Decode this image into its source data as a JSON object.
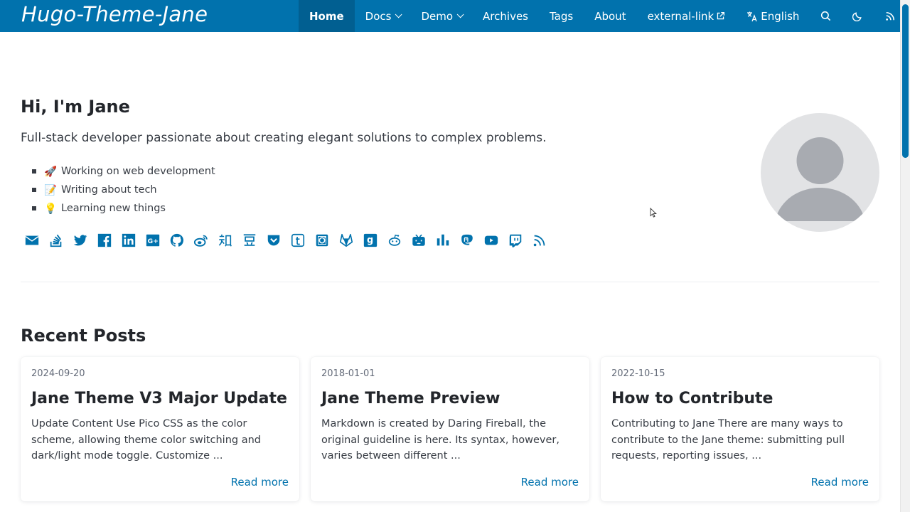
{
  "header": {
    "logo": "Hugo-Theme-Jane",
    "nav": [
      {
        "label": "Home",
        "active": true
      },
      {
        "label": "Docs",
        "dropdown": true
      },
      {
        "label": "Demo",
        "dropdown": true
      },
      {
        "label": "Archives"
      },
      {
        "label": "Tags"
      },
      {
        "label": "About"
      },
      {
        "label": "external-link",
        "icon": "external-link-icon"
      },
      {
        "label": "English",
        "icon": "translate-icon"
      }
    ],
    "icons": [
      "search-icon",
      "moon-icon",
      "rss-icon"
    ],
    "color": "#0172ad"
  },
  "hero": {
    "title": "Hi, I'm Jane",
    "subtitle": "Full-stack developer passionate about creating elegant solutions to complex problems.",
    "items": [
      {
        "emoji": "🚀",
        "text": "Working on web development"
      },
      {
        "emoji": "📝",
        "text": "Writing about tech"
      },
      {
        "emoji": "💡",
        "text": "Learning new things"
      }
    ],
    "socials": [
      "email-icon",
      "stackoverflow-icon",
      "twitter-icon",
      "facebook-icon",
      "linkedin-icon",
      "google-plus-icon",
      "github-icon",
      "weibo-icon",
      "zhihu-icon",
      "douban-icon",
      "pocket-icon",
      "tumblr-icon",
      "instagram-icon",
      "gitlab-icon",
      "goodreads-icon",
      "reddit-icon",
      "bilibili-icon",
      "stats-icon",
      "mastodon-icon",
      "youtube-icon",
      "twitch-icon",
      "rss-icon"
    ]
  },
  "recent": {
    "title": "Recent Posts",
    "posts": [
      {
        "date": "2024-09-20",
        "title": "Jane Theme V3 Major Update",
        "excerpt": "Update Content Use Pico CSS as the color scheme, allowing theme color switching and dark/light mode toggle. Customize ...",
        "more": "Read more"
      },
      {
        "date": "2018-01-01",
        "title": "Jane Theme Preview",
        "excerpt": "Markdown is created by Daring Fireball, the original guideline is here. Its syntax, however, varies between different ...",
        "more": "Read more"
      },
      {
        "date": "2022-10-15",
        "title": "How to Contribute",
        "excerpt": "Contributing to Jane There are many ways to contribute to the Jane theme: submitting pull requests, reporting issues, ...",
        "more": "Read more"
      }
    ]
  }
}
